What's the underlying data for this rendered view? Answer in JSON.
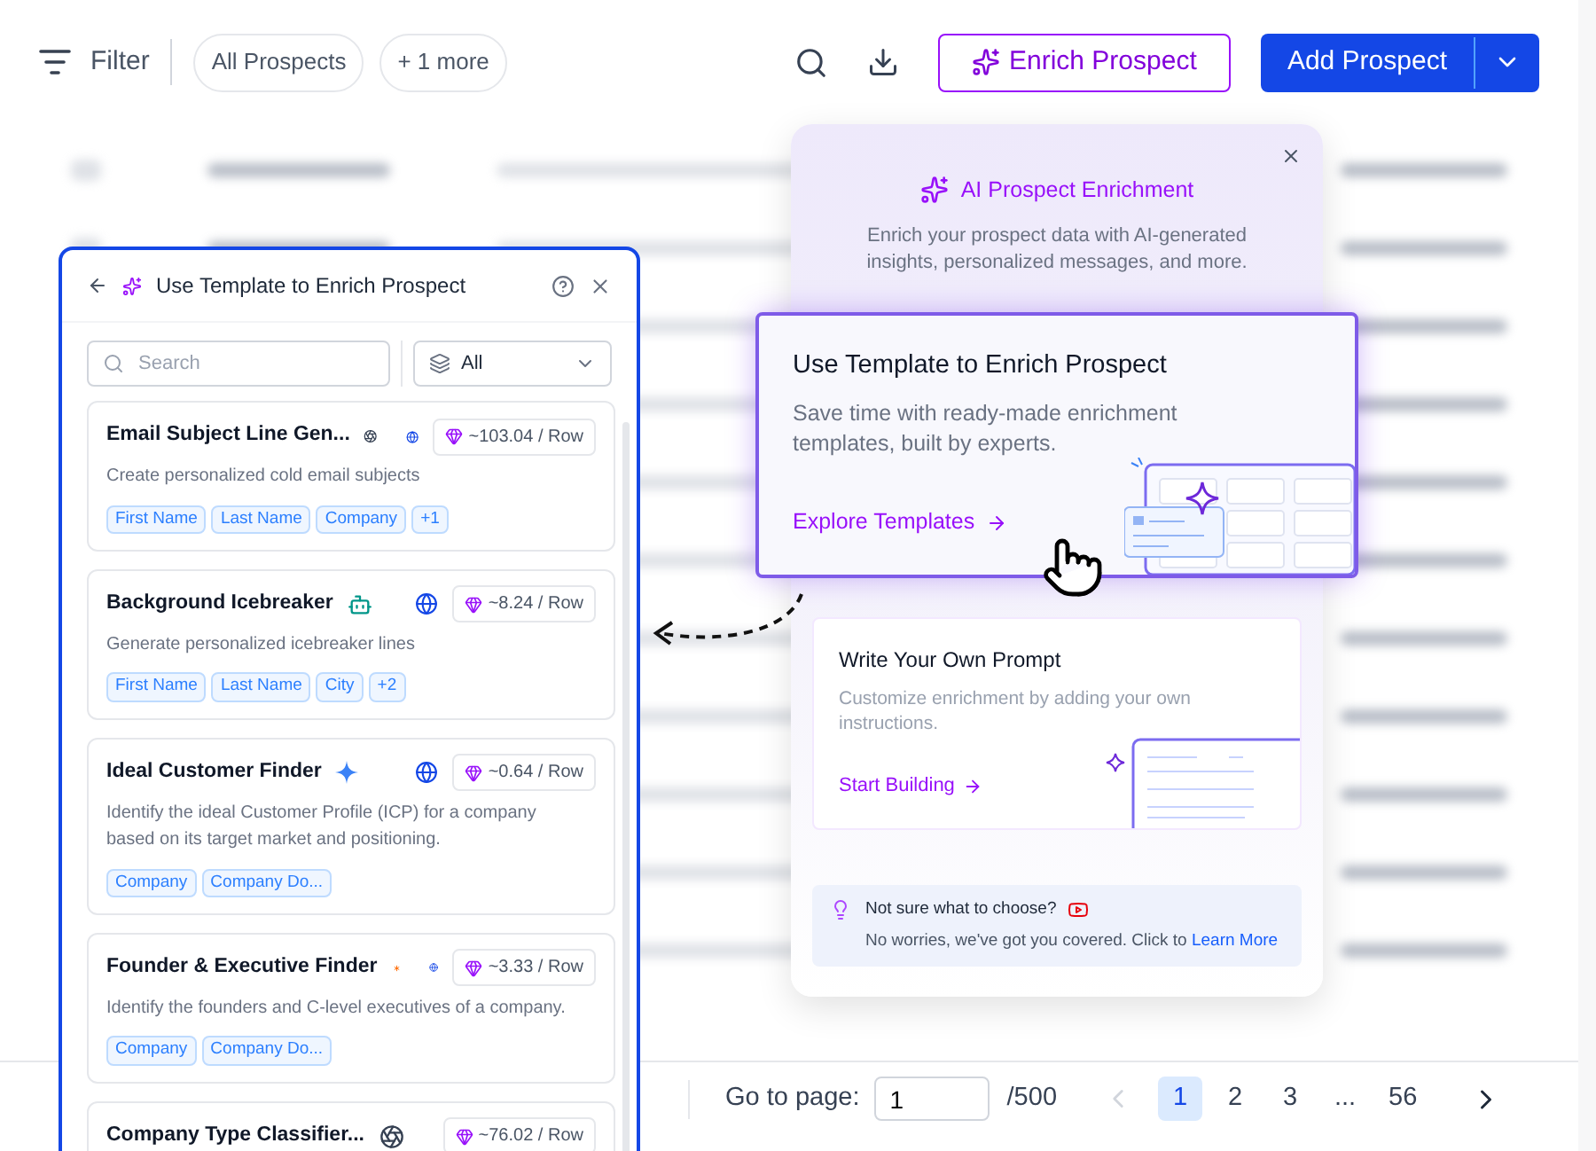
{
  "toolbar": {
    "filter_label": "Filter",
    "chips": [
      "All Prospects",
      "+ 1 more"
    ],
    "enrich_button": "Enrich Prospect",
    "add_button": "Add Prospect"
  },
  "pagination": {
    "goto_label": "Go to page:",
    "goto_value": "1",
    "total": "/500",
    "prev_disabled": true,
    "pages": [
      {
        "label": "1",
        "selected": true
      },
      {
        "label": "2",
        "selected": false
      },
      {
        "label": "3",
        "selected": false
      },
      {
        "label": "...",
        "selected": false
      },
      {
        "label": "56",
        "selected": false
      }
    ]
  },
  "enrichment_popover": {
    "title": "AI Prospect Enrichment",
    "description": "Enrich your prospect data with AI-generated insights, personalized messages, and more.",
    "options": [
      {
        "title": "Use Template to Enrich Prospect",
        "description": "Save time with ready-made enrichment templates, built by experts.",
        "link": "Explore Templates",
        "selected": true
      },
      {
        "title": "Write Your Own Prompt",
        "description": "Customize enrichment by adding your own instructions.",
        "link": "Start Building",
        "selected": false
      }
    ],
    "tip": {
      "title": "Not sure what to choose?",
      "text": "No worries, we've got you covered. Click to",
      "link": "Learn More"
    }
  },
  "template_panel": {
    "title": "Use Template to Enrich Prospect",
    "search": {
      "placeholder": "Search"
    },
    "filter": "All",
    "templates": [
      {
        "name": "Email Subject Line Gen...",
        "kind": "knot",
        "web": true,
        "cost": "~103.04 / Row",
        "description": "Create personalized cold email subjects",
        "tags": [
          "First Name",
          "Last Name",
          "Company",
          "+1"
        ]
      },
      {
        "name": "Background Icebreaker",
        "kind": "robot",
        "web": true,
        "cost": "~8.24 / Row",
        "description": "Generate personalized icebreaker lines",
        "tags": [
          "First Name",
          "Last Name",
          "City",
          "+2"
        ]
      },
      {
        "name": "Ideal Customer Finder",
        "kind": "sparkle",
        "web": true,
        "cost": "~0.64 / Row",
        "description": "Identify the ideal Customer Profile (ICP) for a company based on its target market and positioning.",
        "tags": [
          "Company",
          "Company Do..."
        ]
      },
      {
        "name": "Founder & Executive Finder",
        "kind": "burst",
        "web": true,
        "cost": "~3.33 / Row",
        "description": "Identify the founders and C-level executives of a company.",
        "tags": [
          "Company",
          "Company Do..."
        ]
      },
      {
        "name": "Company Type Classifier...",
        "kind": "knot",
        "web": false,
        "cost": "~76.02 / Row"
      }
    ]
  }
}
